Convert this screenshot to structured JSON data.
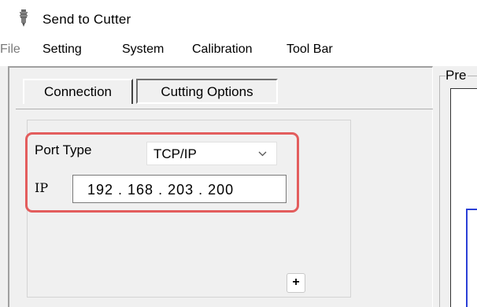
{
  "window": {
    "title": "Send to Cutter",
    "icon": "cutter-blade-icon"
  },
  "menu": {
    "items": [
      "File",
      "Setting",
      "System",
      "Calibration",
      "Tool Bar"
    ]
  },
  "tabs": [
    {
      "label": "Connection",
      "active": true
    },
    {
      "label": "Cutting Options",
      "active": false
    }
  ],
  "connection": {
    "port_type_label": "Port Type",
    "port_type_value": "TCP/IP",
    "ip_label": "IP",
    "ip_value": "192 . 168 . 203 . 200",
    "add_button_label": "+"
  },
  "preview": {
    "legend": "Pre"
  },
  "colors": {
    "highlight": "#e35d5d",
    "preview_line": "#2a3fd6"
  }
}
